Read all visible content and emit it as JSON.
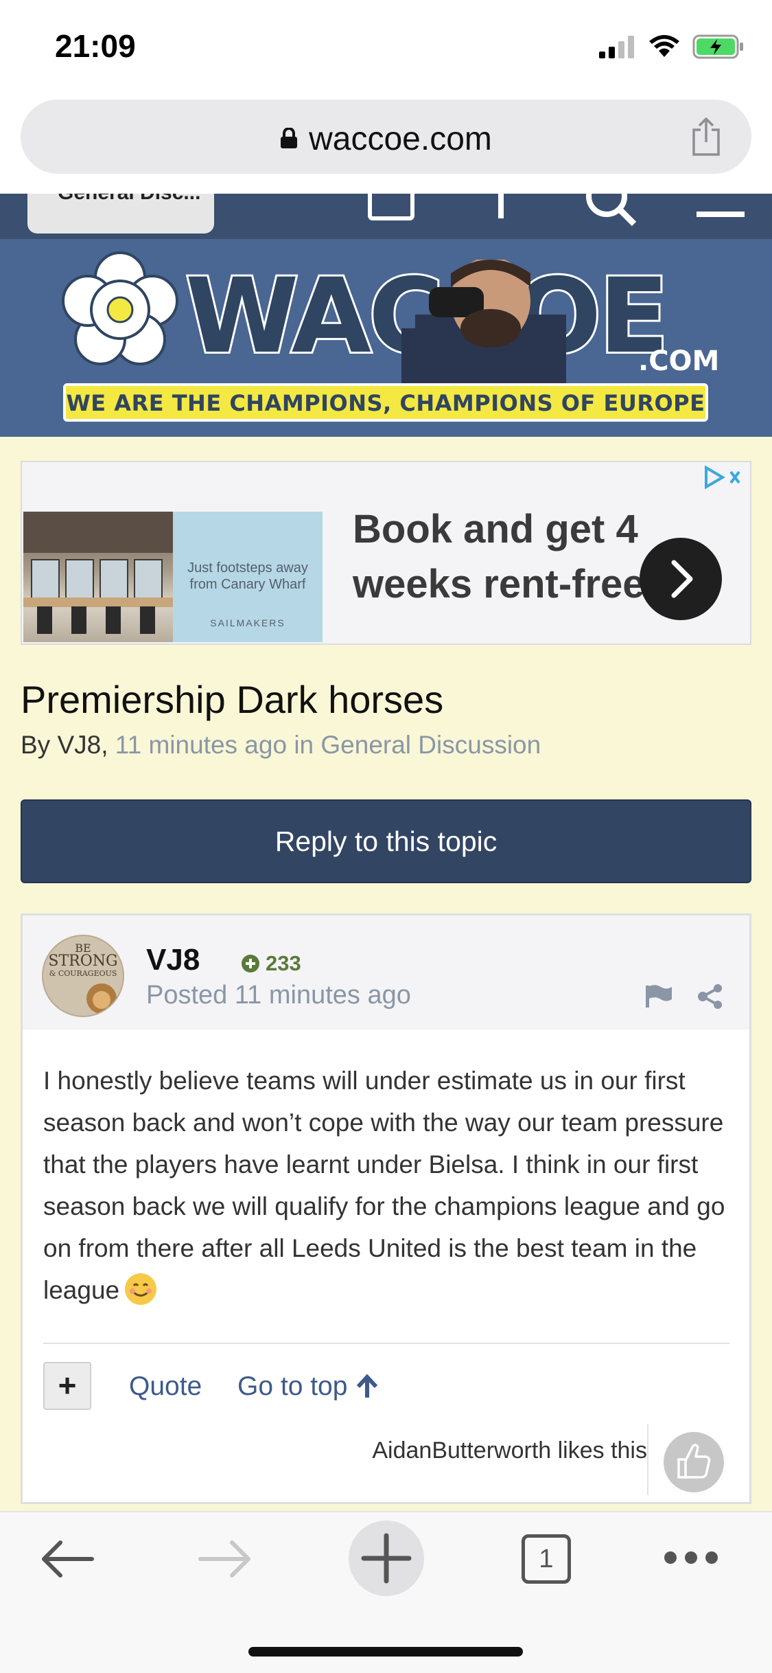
{
  "status_bar": {
    "time": "21:09"
  },
  "browser": {
    "url": "waccoe.com",
    "tab_count": "1"
  },
  "site": {
    "forum_chip": "General Disc...",
    "logo_text": "WACCOE",
    "logo_suffix": ".COM",
    "tagline": "WE ARE THE CHAMPIONS, CHAMPIONS OF EUROPE"
  },
  "ad": {
    "small_text": "Just footsteps away from Canary Wharf",
    "brand": "SAILMAKERS",
    "headline": "Book and get 4 weeks rent-free"
  },
  "topic": {
    "title": "Premiership Dark horses",
    "by_prefix": "By VJ8,",
    "meta_time": "11 minutes ago in General Discussion",
    "reply_label": "Reply to this topic"
  },
  "post": {
    "author": "VJ8",
    "reputation": "233",
    "posted": "Posted 11 minutes ago",
    "avatar_line1": "BE",
    "avatar_line2": "STRONG",
    "avatar_line3": "& COURAGEOUS",
    "body": "I honestly believe teams will under estimate us in our first season back and won’t cope with the way our team pressure that the players have learnt under Bielsa. I think in our first season back we will qualify for the champions league and go on from there after all Leeds United is the best team in the league",
    "plus_label": "+",
    "quote_label": "Quote",
    "go_to_top_label": "Go to top",
    "likes_text": "AidanButterworth likes this"
  }
}
